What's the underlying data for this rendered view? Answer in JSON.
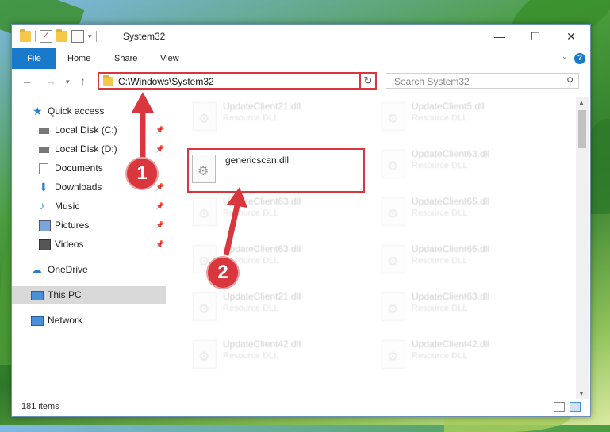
{
  "window": {
    "title": "System32",
    "controls": [
      "—",
      "☐",
      "✕"
    ]
  },
  "ribbon": {
    "tabs": [
      "File",
      "Home",
      "Share",
      "View"
    ],
    "help": "?"
  },
  "address": {
    "path": "C:\\Windows\\System32"
  },
  "search": {
    "placeholder": "Search System32"
  },
  "sidebar": {
    "items": [
      {
        "label": "Quick access",
        "icon": "star-icon"
      },
      {
        "label": "Local Disk (C:)",
        "icon": "drive-icon"
      },
      {
        "label": "Local Disk (D:)",
        "icon": "drive-icon"
      },
      {
        "label": "Documents",
        "icon": "documents-icon"
      },
      {
        "label": "Downloads",
        "icon": "download-icon"
      },
      {
        "label": "Music",
        "icon": "music-icon"
      },
      {
        "label": "Pictures",
        "icon": "pictures-icon"
      },
      {
        "label": "Videos",
        "icon": "videos-icon"
      },
      {
        "label": "OneDrive",
        "icon": "cloud-icon"
      },
      {
        "label": "This PC",
        "icon": "computer-icon"
      },
      {
        "label": "Network",
        "icon": "network-icon"
      }
    ]
  },
  "files": {
    "highlighted": {
      "name": "genericscan.dll"
    },
    "background": [
      {
        "name": "UpdateClient21.dll",
        "type": "Resource DLL"
      },
      {
        "name": "UpdateClient5.dll",
        "type": "Resource DLL"
      },
      {
        "name": "UpdateClient63.dll",
        "type": "Resource DLL"
      },
      {
        "name": "UpdateClient63.dll",
        "type": "Resource DLL"
      },
      {
        "name": "UpdateClient65.dll",
        "type": "Resource DLL"
      },
      {
        "name": "UpdateClient63.dll",
        "type": "Resource DLL"
      },
      {
        "name": "UpdateClient65.dll",
        "type": "Resource DLL"
      },
      {
        "name": "UpdateClient21.dll",
        "type": "Resource DLL"
      },
      {
        "name": "UpdateClient63.dll",
        "type": "Resource DLL"
      },
      {
        "name": "UpdateClient42.dll",
        "type": "Resource DLL"
      },
      {
        "name": "UpdateClient42.dll",
        "type": "Resource DLL"
      }
    ]
  },
  "status": {
    "items": "181 items"
  },
  "annotations": {
    "step1": "1",
    "step2": "2",
    "color": "#d9363e"
  }
}
